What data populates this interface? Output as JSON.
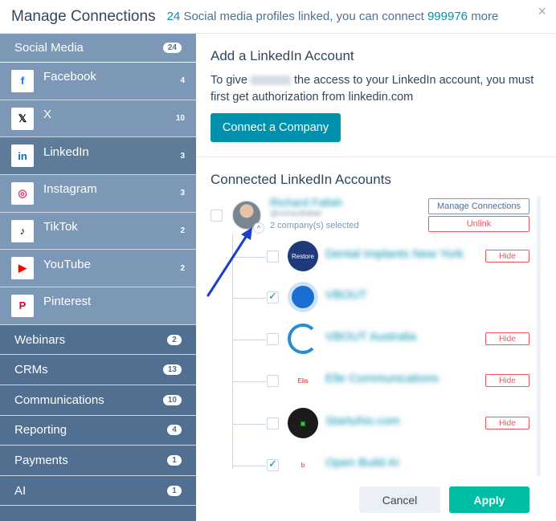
{
  "header": {
    "title": "Manage Connections",
    "count": "24",
    "sub_middle": "Social media profiles linked, you can connect",
    "remaining": "999976",
    "sub_end": "more",
    "close": "×"
  },
  "sidebar": {
    "social_label": "Social Media",
    "social_count": "24",
    "networks": [
      {
        "label": "Facebook",
        "count": "4",
        "icon": "facebook-icon",
        "glyph": "f",
        "color": "#1877f2"
      },
      {
        "label": "X",
        "count": "10",
        "icon": "x-icon",
        "glyph": "𝕏",
        "color": "#000000"
      },
      {
        "label": "LinkedIn",
        "count": "3",
        "icon": "linkedin-icon",
        "glyph": "in",
        "color": "#0a66c2"
      },
      {
        "label": "Instagram",
        "count": "3",
        "icon": "instagram-icon",
        "glyph": "◎",
        "color": "#e1306c"
      },
      {
        "label": "TikTok",
        "count": "2",
        "icon": "tiktok-icon",
        "glyph": "♪",
        "color": "#000000"
      },
      {
        "label": "YouTube",
        "count": "2",
        "icon": "youtube-icon",
        "glyph": "▶",
        "color": "#ff0000"
      },
      {
        "label": "Pinterest",
        "count": "",
        "icon": "pinterest-icon",
        "glyph": "P",
        "color": "#e60023"
      }
    ],
    "categories": [
      {
        "label": "Webinars",
        "count": "2"
      },
      {
        "label": "CRMs",
        "count": "13"
      },
      {
        "label": "Communications",
        "count": "10"
      },
      {
        "label": "Reporting",
        "count": "4"
      },
      {
        "label": "Payments",
        "count": "1"
      },
      {
        "label": "AI",
        "count": "1"
      }
    ]
  },
  "main": {
    "add_title": "Add a LinkedIn Account",
    "add_desc_a": "To give",
    "add_desc_b": "the access to your LinkedIn account, you must first get authorization from linkedin.com",
    "connect_button": "Connect a Company",
    "connected_title": "Connected LinkedIn Accounts",
    "account": {
      "name": "Richard Fallah",
      "handle": "@richardfallah",
      "selected": "2 company(s) selected",
      "manage_button": "Manage Connections",
      "unlink_button": "Unlink"
    },
    "companies": [
      {
        "name": "Dental Implants New York",
        "checked": false,
        "hide": "Hide"
      },
      {
        "name": "VBOUT",
        "checked": true,
        "hide": ""
      },
      {
        "name": "VBOUT Australia",
        "checked": false,
        "hide": "Hide"
      },
      {
        "name": "Elle Communications",
        "checked": false,
        "hide": "Hide"
      },
      {
        "name": "Startuhio.com",
        "checked": false,
        "hide": "Hide"
      },
      {
        "name": "Open Build AI",
        "checked": true,
        "hide": ""
      }
    ],
    "cancel_button": "Cancel",
    "apply_button": "Apply"
  }
}
